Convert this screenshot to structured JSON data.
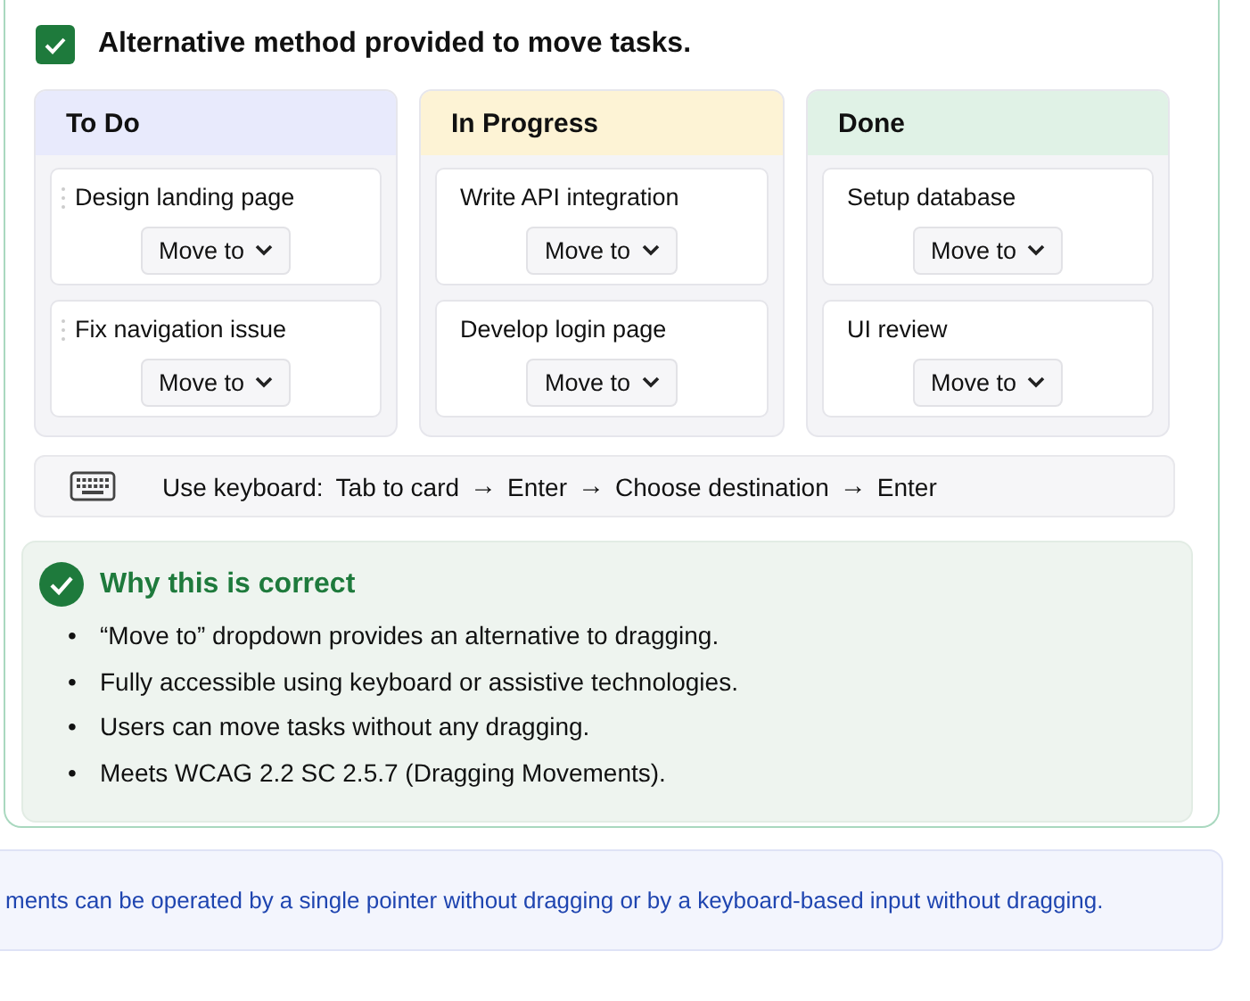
{
  "result": {
    "checked": true,
    "title": "Alternative method provided to move tasks."
  },
  "columns": [
    {
      "title": "To Do",
      "color": "#e8eafc",
      "cards": [
        {
          "title": "Design landing page",
          "handle": true,
          "button": "Move to"
        },
        {
          "title": "Fix navigation issue",
          "handle": true,
          "button": "Move to"
        }
      ]
    },
    {
      "title": "In Progress",
      "color": "#fdf3d5",
      "cards": [
        {
          "title": "Write API integration",
          "handle": false,
          "button": "Move to"
        },
        {
          "title": "Develop login page",
          "handle": false,
          "button": "Move to"
        }
      ]
    },
    {
      "title": "Done",
      "color": "#e0f2e6",
      "cards": [
        {
          "title": "Setup database",
          "handle": false,
          "button": "Move to"
        },
        {
          "title": "UI review",
          "handle": false,
          "button": "Move to"
        }
      ]
    }
  ],
  "keyboard_hint": {
    "label": "Use keyboard:",
    "steps": [
      "Tab to card",
      "Enter",
      "Choose destination",
      "Enter"
    ],
    "separator": "→"
  },
  "explanation": {
    "title": "Why this is correct",
    "bullet": "•",
    "points": [
      "“Move to” dropdown provides an alternative to dragging.",
      "Fully accessible using keyboard or assistive technologies.",
      "Users can move tasks without any dragging.",
      "Meets WCAG 2.2 SC 2.5.7 (Dragging Movements)."
    ]
  },
  "note": "ments can be operated by a single pointer without dragging or by a keyboard-based input without dragging."
}
